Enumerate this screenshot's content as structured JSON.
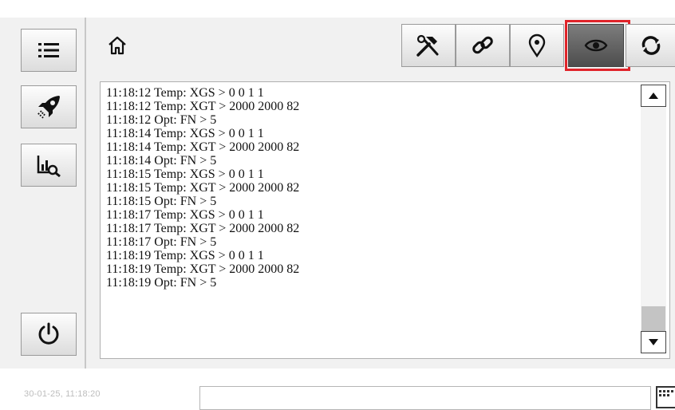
{
  "sidebar": {
    "buttons": [
      {
        "icon": "list-icon"
      },
      {
        "icon": "rocket-icon"
      },
      {
        "icon": "chart-search-icon"
      },
      {
        "icon": "power-icon"
      }
    ]
  },
  "toolbar": {
    "home_icon": "home-icon",
    "buttons": [
      {
        "icon": "tools-icon"
      },
      {
        "icon": "link-icon"
      },
      {
        "icon": "location-pin-icon"
      },
      {
        "icon": "eye-icon",
        "active": true
      },
      {
        "icon": "sync-icon"
      }
    ],
    "highlight_color": "#e0242a"
  },
  "log": {
    "lines": [
      "11:18:12 Temp: XGS > 0 0 1 1",
      "11:18:12 Temp: XGT > 2000 2000 82",
      "11:18:12 Opt: FN > 5",
      "11:18:14 Temp: XGS > 0 0 1 1",
      "11:18:14 Temp: XGT > 2000 2000 82",
      "11:18:14 Opt: FN > 5",
      "11:18:15 Temp: XGS > 0 0 1 1",
      "11:18:15 Temp: XGT > 2000 2000 82",
      "11:18:15 Opt: FN > 5",
      "11:18:17 Temp: XGS > 0 0 1 1",
      "11:18:17 Temp: XGT > 2000 2000 82",
      "11:18:17 Opt: FN > 5",
      "11:18:19 Temp: XGS > 0 0 1 1",
      "11:18:19 Temp: XGT > 2000 2000 82",
      "11:18:19 Opt: FN > 5"
    ],
    "scroll_position": 1.0
  },
  "footer": {
    "timestamp": "30-01-25, 11:18:20",
    "command_input_value": ""
  }
}
